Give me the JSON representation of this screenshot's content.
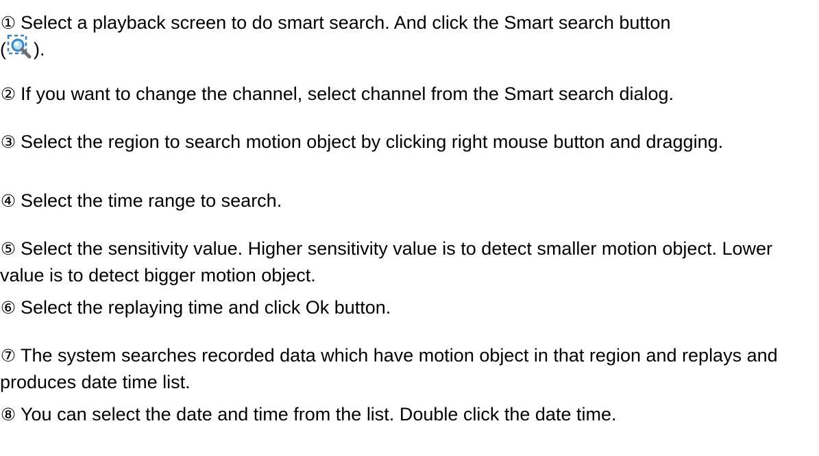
{
  "steps": [
    {
      "number": "①",
      "text": "Select a playback screen to do smart search. And click the Smart search button",
      "after_open": "(",
      "after_close": ")."
    },
    {
      "number": "②",
      "text": "If you want to change the channel, select channel from the Smart search dialog."
    },
    {
      "number": "③",
      "text": "Select the region to search motion object by clicking right mouse button and dragging."
    },
    {
      "number": "④",
      "text": "Select the time range to search."
    },
    {
      "number": "⑤",
      "text": "Select the sensitivity value. Higher sensitivity value is to detect smaller motion object. Lower value is to detect bigger motion object."
    },
    {
      "number": "⑥",
      "text": "Select the replaying time and click Ok button."
    },
    {
      "number": "⑦",
      "text": "The system searches recorded data which have motion object in that region and replays and produces date time list."
    },
    {
      "number": "⑧",
      "text": "You can select the date and time from the list. Double click the date time."
    }
  ],
  "icons": {
    "smart_search": "smart-search-icon"
  },
  "colors": {
    "text": "#000000",
    "icon_dash": "#3a7fd0",
    "icon_lens": "#4aa3e6",
    "icon_handle": "#7a7a7a"
  }
}
